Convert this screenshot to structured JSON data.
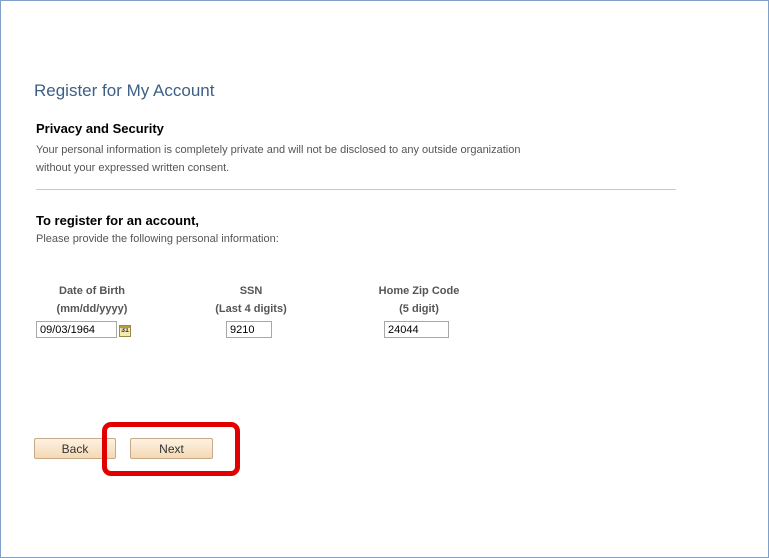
{
  "page": {
    "title": "Register for My Account"
  },
  "privacy": {
    "heading": "Privacy and Security",
    "line1": "Your personal information is completely private and will not be disclosed to any outside organization",
    "line2": "without your expressed written consent."
  },
  "register": {
    "heading": "To register for an account,",
    "subtext": "Please provide the following personal information:"
  },
  "fields": {
    "dob": {
      "label1": "Date of Birth",
      "label2": "(mm/dd/yyyy)",
      "value": "09/03/1964",
      "calendar_glyph": "31"
    },
    "ssn": {
      "label1": "SSN",
      "label2": "(Last 4 digits)",
      "value": "9210"
    },
    "zip": {
      "label1": "Home Zip Code",
      "label2": "(5 digit)",
      "value": "24044"
    }
  },
  "buttons": {
    "back": "Back",
    "next": "Next"
  },
  "colors": {
    "title": "#3d5f86",
    "highlight": "#e10000",
    "button_bg": "#f4d9b3",
    "frame": "#7fa0c8"
  }
}
